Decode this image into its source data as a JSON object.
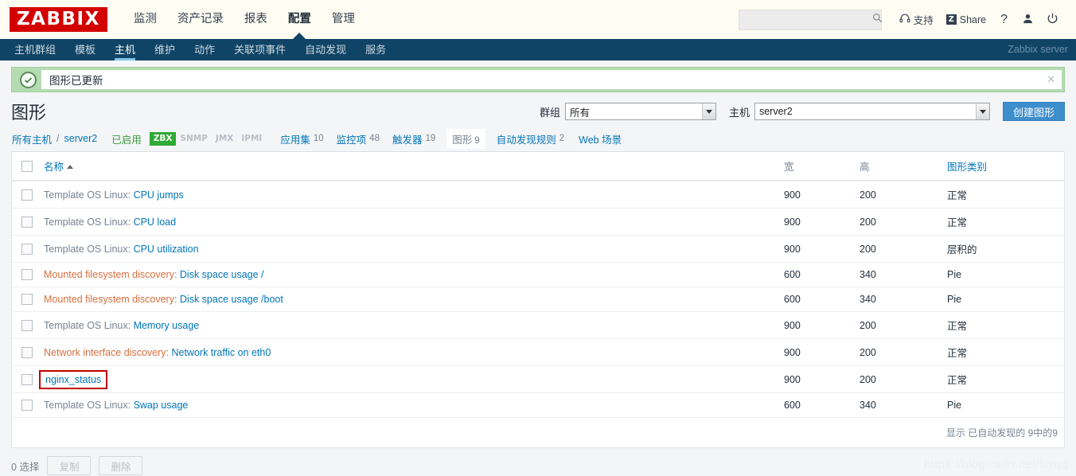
{
  "header": {
    "logo_text": "ZABBIX",
    "nav": [
      {
        "label": "监测",
        "active": false
      },
      {
        "label": "资产记录",
        "active": false
      },
      {
        "label": "报表",
        "active": false
      },
      {
        "label": "配置",
        "active": true
      },
      {
        "label": "管理",
        "active": false
      }
    ],
    "search": {
      "value": "",
      "placeholder": "",
      "icon": "search-icon"
    },
    "support_label": "支持",
    "share_label": "Share",
    "share_badge": "Z",
    "help_label": "?",
    "user_icon": "user-icon",
    "power_icon": "power-icon",
    "logo_bg": "#d40000"
  },
  "subnav": {
    "items": [
      {
        "label": "主机群组",
        "active": false
      },
      {
        "label": "模板",
        "active": false
      },
      {
        "label": "主机",
        "active": true
      },
      {
        "label": "维护",
        "active": false
      },
      {
        "label": "动作",
        "active": false
      },
      {
        "label": "关联项事件",
        "active": false
      },
      {
        "label": "自动发现",
        "active": false
      },
      {
        "label": "服务",
        "active": false
      }
    ],
    "server_label": "Zabbix server",
    "bg": "#0f4466",
    "active_underline": "#7fc5e8"
  },
  "message": {
    "text": "图形已更新",
    "icon": "check-circle-icon",
    "close_icon": "close-icon",
    "close_label": "×",
    "bg": "#b5dbb3"
  },
  "page": {
    "title": "图形",
    "filters": {
      "group_label": "群组",
      "group_value": "所有",
      "host_label": "主机",
      "host_value": "server2"
    },
    "create_button": "创建图形"
  },
  "objnav": {
    "breadcrumb_all": "所有主机",
    "breadcrumb_sep": "/",
    "breadcrumb_host": "server2",
    "status": "已启用",
    "iface_flags": [
      {
        "label": "ZBX",
        "active": true
      },
      {
        "label": "SNMP",
        "active": false
      },
      {
        "label": "JMX",
        "active": false
      },
      {
        "label": "IPMI",
        "active": false
      }
    ],
    "links": [
      {
        "label": "应用集",
        "count": "10",
        "selected": false
      },
      {
        "label": "监控项",
        "count": "48",
        "selected": false
      },
      {
        "label": "触发器",
        "count": "19",
        "selected": false
      },
      {
        "label": "图形",
        "count": "9",
        "selected": true
      },
      {
        "label": "自动发现规则",
        "count": "2",
        "selected": false
      },
      {
        "label": "Web 场景",
        "count": "",
        "selected": false
      }
    ]
  },
  "table": {
    "columns": [
      {
        "key": "checkbox",
        "label": "",
        "sortable": false
      },
      {
        "key": "name",
        "label": "名称",
        "sortable": true,
        "sort": "asc"
      },
      {
        "key": "width",
        "label": "宽",
        "sortable": false
      },
      {
        "key": "height",
        "label": "高",
        "sortable": false
      },
      {
        "key": "type",
        "label": "图形类别",
        "sortable": true
      }
    ],
    "rows": [
      {
        "prefix": "Template OS Linux",
        "prefix_kind": "template",
        "name": "CPU jumps",
        "width": "900",
        "height": "200",
        "type": "正常",
        "highlight": false
      },
      {
        "prefix": "Template OS Linux",
        "prefix_kind": "template",
        "name": "CPU load",
        "width": "900",
        "height": "200",
        "type": "正常",
        "highlight": false
      },
      {
        "prefix": "Template OS Linux",
        "prefix_kind": "template",
        "name": "CPU utilization",
        "width": "900",
        "height": "200",
        "type": "层积的",
        "highlight": false
      },
      {
        "prefix": "Mounted filesystem discovery",
        "prefix_kind": "discovery",
        "name": "Disk space usage /",
        "width": "600",
        "height": "340",
        "type": "Pie",
        "highlight": false
      },
      {
        "prefix": "Mounted filesystem discovery",
        "prefix_kind": "discovery",
        "name": "Disk space usage /boot",
        "width": "600",
        "height": "340",
        "type": "Pie",
        "highlight": false
      },
      {
        "prefix": "Template OS Linux",
        "prefix_kind": "template",
        "name": "Memory usage",
        "width": "900",
        "height": "200",
        "type": "正常",
        "highlight": false
      },
      {
        "prefix": "Network interface discovery",
        "prefix_kind": "discovery",
        "name": "Network traffic on eth0",
        "width": "900",
        "height": "200",
        "type": "正常",
        "highlight": false
      },
      {
        "prefix": "",
        "prefix_kind": "none",
        "name": "nginx_status",
        "width": "900",
        "height": "200",
        "type": "正常",
        "highlight": true
      },
      {
        "prefix": "Template OS Linux",
        "prefix_kind": "template",
        "name": "Swap usage",
        "width": "600",
        "height": "340",
        "type": "Pie",
        "highlight": false
      }
    ],
    "footer_text": "显示 已自动发现的 9中的9"
  },
  "actionbar": {
    "selected_text": "0 选择",
    "copy_button": "复制",
    "delete_button": "删除"
  },
  "watermark": "https://blog.csdn.net/lilyqq"
}
